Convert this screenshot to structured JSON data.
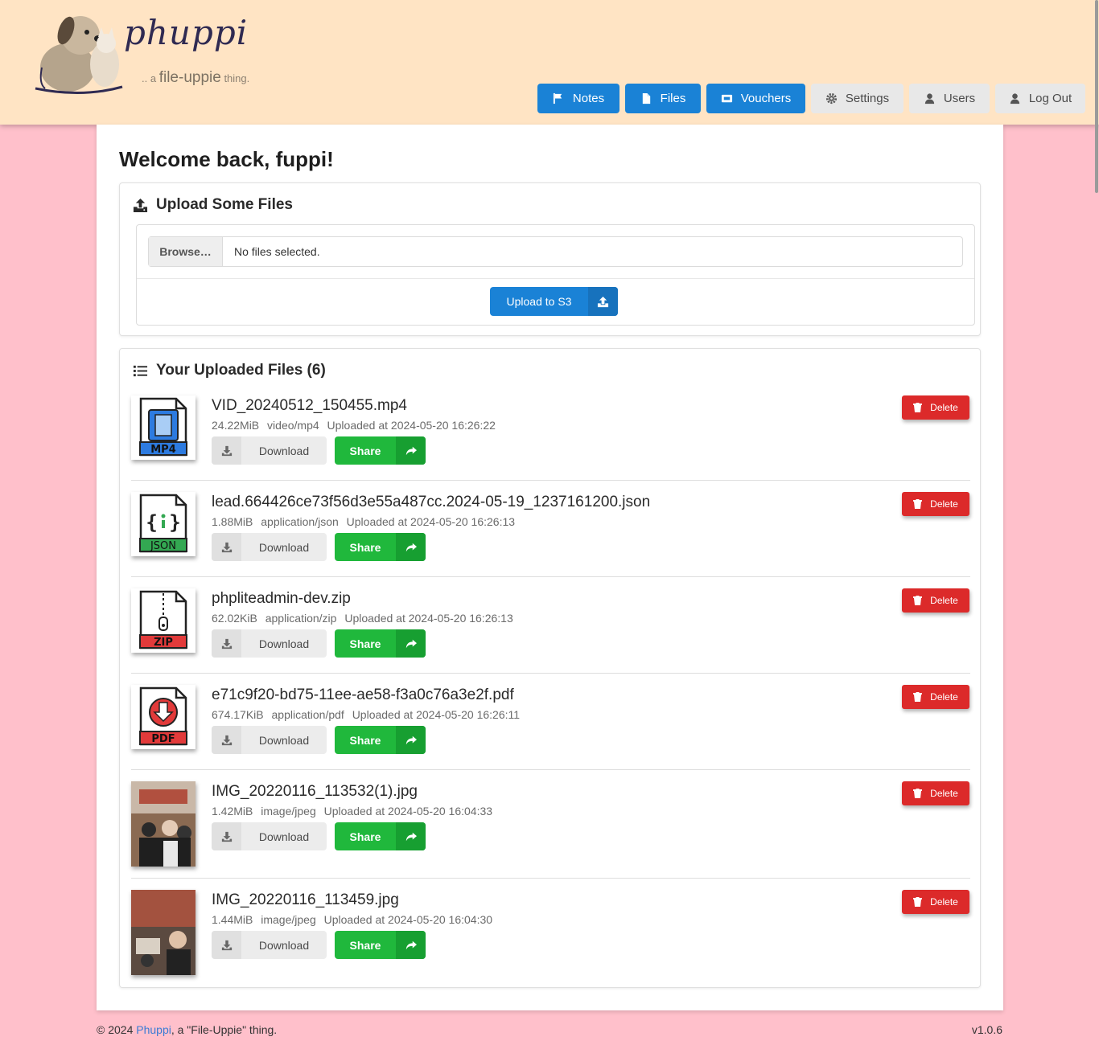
{
  "brand": {
    "name": "phuppi",
    "tagline_prefix": ".. a",
    "tagline_main": "file-uppie",
    "tagline_suffix": "thing."
  },
  "nav": [
    {
      "label": "Notes",
      "icon": "flag-icon",
      "style": "primary"
    },
    {
      "label": "Files",
      "icon": "file-icon",
      "style": "primary"
    },
    {
      "label": "Vouchers",
      "icon": "ticket-icon",
      "style": "primary"
    },
    {
      "label": "Settings",
      "icon": "gear-icon",
      "style": "default"
    },
    {
      "label": "Users",
      "icon": "user-icon",
      "style": "default"
    },
    {
      "label": "Log Out",
      "icon": "user-icon",
      "style": "default"
    }
  ],
  "welcome": "Welcome back, fuppi!",
  "upload": {
    "title": "Upload Some Files",
    "browse_label": "Browse…",
    "no_files": "No files selected.",
    "button_label": "Upload to S3"
  },
  "files_section": {
    "title": "Your Uploaded Files (6)"
  },
  "file_actions": {
    "download": "Download",
    "share": "Share",
    "delete": "Delete"
  },
  "files": [
    {
      "name": "VID_20240512_150455.mp4",
      "size": "24.22MiB",
      "type": "video/mp4",
      "uploaded": "Uploaded at 2024-05-20 16:26:22",
      "thumb": "mp4-file-icon",
      "badge": "MP4",
      "badge_color": "#2d7be0"
    },
    {
      "name": "lead.664426ce73f56d3e55a487cc.2024-05-19_1237161200.json",
      "size": "1.88MiB",
      "type": "application/json",
      "uploaded": "Uploaded at 2024-05-20 16:26:13",
      "thumb": "json-file-icon",
      "badge": "JSON",
      "badge_color": "#33a852"
    },
    {
      "name": "phpliteadmin-dev.zip",
      "size": "62.02KiB",
      "type": "application/zip",
      "uploaded": "Uploaded at 2024-05-20 16:26:13",
      "thumb": "zip-file-icon",
      "badge": "ZIP",
      "badge_color": "#e23a3a"
    },
    {
      "name": "e71c9f20-bd75-11ee-ae58-f3a0c76a3e2f.pdf",
      "size": "674.17KiB",
      "type": "application/pdf",
      "uploaded": "Uploaded at 2024-05-20 16:26:11",
      "thumb": "pdf-file-icon",
      "badge": "PDF",
      "badge_color": "#e23a3a"
    },
    {
      "name": "IMG_20220116_113532(1).jpg",
      "size": "1.42MiB",
      "type": "image/jpeg",
      "uploaded": "Uploaded at 2024-05-20 16:04:33",
      "thumb": "photo-thumbnail"
    },
    {
      "name": "IMG_20220116_113459.jpg",
      "size": "1.44MiB",
      "type": "image/jpeg",
      "uploaded": "Uploaded at 2024-05-20 16:04:30",
      "thumb": "photo-thumbnail"
    }
  ],
  "footer": {
    "copyright": "© 2024",
    "link": "Phuppi",
    "suffix": ", a \"File-Uppie\" thing.",
    "version": "v1.0.6"
  },
  "colors": {
    "header_bg": "#ffe4c4",
    "page_bg": "#ffc0cb",
    "primary": "#1a82d6",
    "success": "#20b83c",
    "danger": "#dc2a2a"
  }
}
